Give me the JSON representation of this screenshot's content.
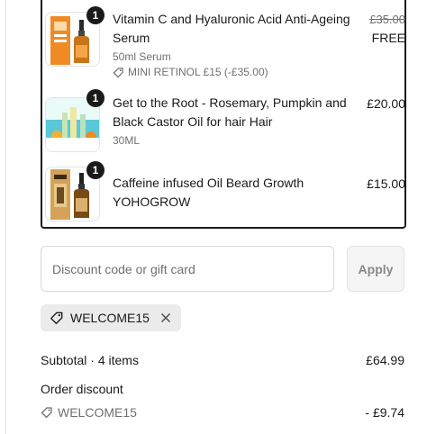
{
  "items": [
    {
      "title": "Vitamin C and Hyaluronic Acid Anti-Ageing Serum",
      "qty": "1",
      "variant": "50ml Serum",
      "promo": "MINI RETINOL £15 (-£35.00)",
      "original_price": "£35.00",
      "price": "FREE",
      "thumb_icon": "serum-bottle-icon"
    },
    {
      "title": "Get to the Root - Rosemary, Pumpkin and Black Castor Oil for hair Hair",
      "qty": "1",
      "variant": "30ML",
      "price": "£20.00",
      "thumb_icon": "hair-oil-bottles-icon"
    },
    {
      "title": "Caffeine infused Oil Beard Growth YOHOGROW",
      "qty": "1",
      "price": "£15.00",
      "thumb_icon": "beard-oil-bottle-icon"
    }
  ],
  "discount": {
    "placeholder": "Discount code or gift card",
    "apply_label": "Apply",
    "applied_code": "WELCOME15"
  },
  "summary": {
    "subtotal_label": "Subtotal · 4 items",
    "subtotal_value": "£64.99",
    "order_discount_label": "Order discount",
    "discount_code": "WELCOME15",
    "discount_value": "- £9.74"
  },
  "colors": {
    "text": "#1a1a1a",
    "muted": "#707070",
    "border": "#d9d9d9",
    "badge": "#1a1a1a"
  }
}
